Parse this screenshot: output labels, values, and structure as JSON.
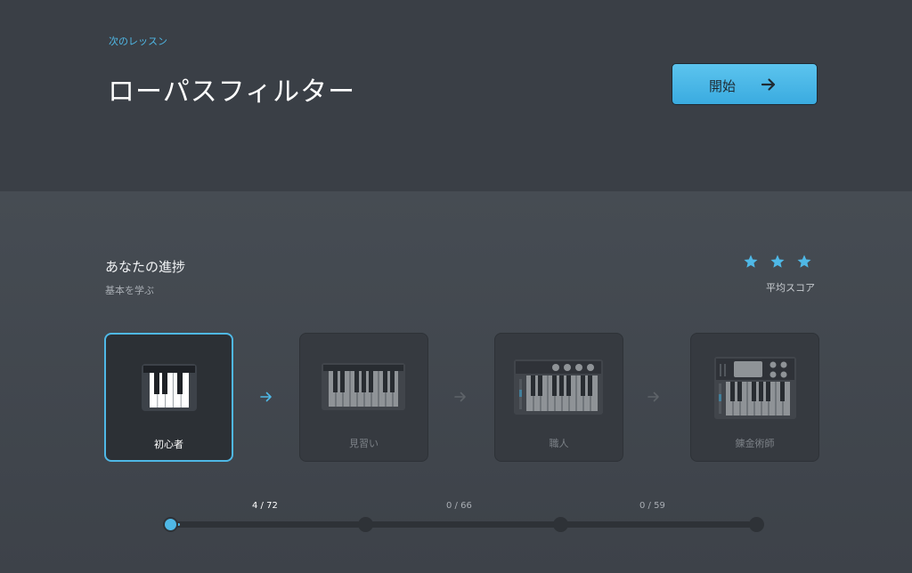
{
  "header": {
    "next_label": "次のレッスン",
    "lesson_title": "ローパスフィルター",
    "start_label": "開始"
  },
  "progress": {
    "title": "あなたの進捗",
    "subtitle": "基本を学ぶ",
    "avg_score_label": "平均スコア",
    "stars": 3
  },
  "levels": [
    {
      "name": "初心者",
      "count": "4 / 72",
      "completed": 4,
      "total": 72
    },
    {
      "name": "見習い",
      "count": "0 / 66",
      "completed": 0,
      "total": 66
    },
    {
      "name": "職人",
      "count": "0 / 59",
      "completed": 0,
      "total": 59
    },
    {
      "name": "錬金術師"
    }
  ],
  "colors": {
    "accent": "#4fb8e6",
    "header_bg": "#3a3f46",
    "body_bg": "#454b52"
  }
}
